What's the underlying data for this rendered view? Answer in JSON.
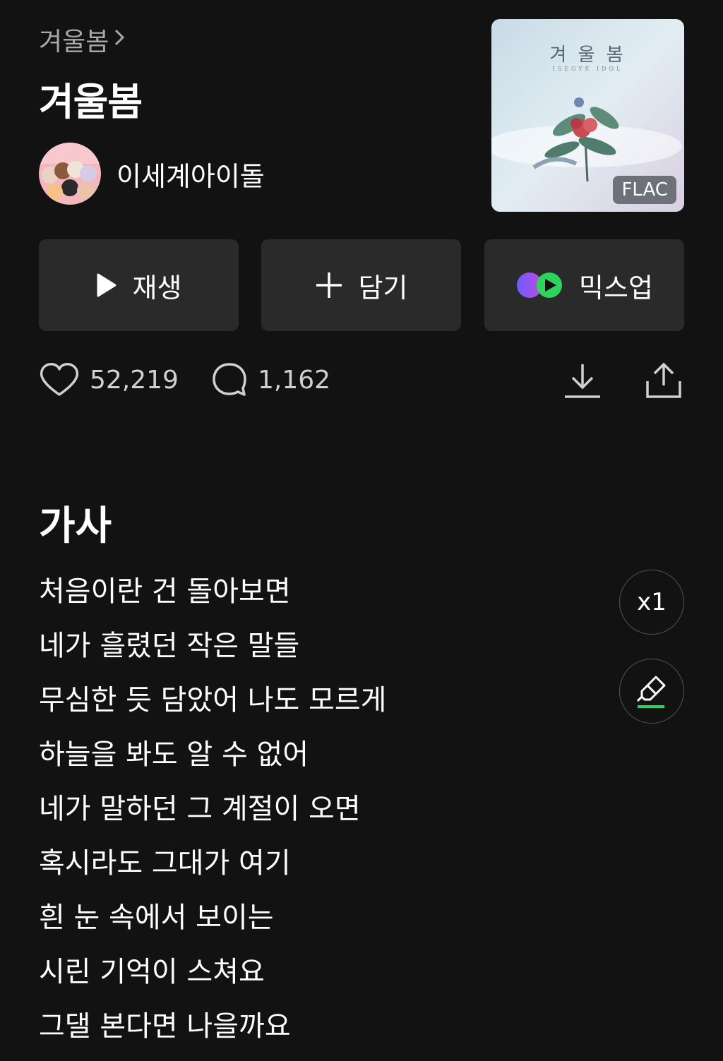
{
  "album": {
    "breadcrumb": "겨울봄",
    "title": "겨울봄",
    "artist": "이세계아이돌",
    "cover_title": "겨 울 봄",
    "cover_subtitle": "ISEGYE IDOL",
    "quality_badge": "FLAC",
    "avatar_text": "이세계아이돌"
  },
  "actions": {
    "play_label": "재생",
    "add_label": "담기",
    "mixup_label": "믹스업"
  },
  "stats": {
    "likes": "52,219",
    "comments": "1,162"
  },
  "lyrics": {
    "heading": "가사",
    "speed": "x1",
    "lines": [
      "처음이란 건 돌아보면",
      "네가 흘렸던 작은 말들",
      "무심한 듯 담았어 나도 모르게",
      "하늘을 봐도 알 수 없어",
      "네가 말하던 그 계절이 오면",
      "혹시라도 그대가 여기",
      "흰 눈 속에서 보이는",
      "시린 기억이 스쳐요",
      "그댈 본다면 나을까요"
    ]
  },
  "colors": {
    "background": "#121212",
    "button_bg": "#2a2a2a",
    "accent_green": "#2fd35c"
  }
}
